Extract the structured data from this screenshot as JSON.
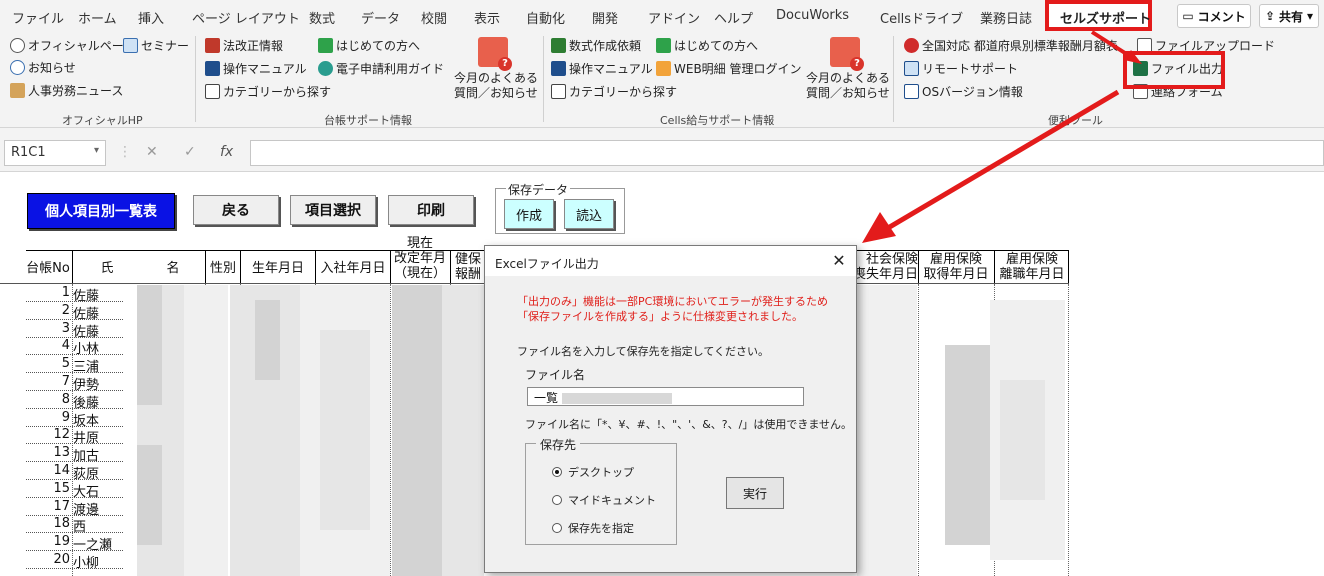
{
  "tabs": [
    "ファイル",
    "ホーム",
    "挿入",
    "ページ レイアウト",
    "数式",
    "データ",
    "校閲",
    "表示",
    "自動化",
    "開発",
    "アドイン",
    "ヘルプ",
    "DocuWorks",
    "Cellsドライブ",
    "業務日誌",
    "セルズサポート"
  ],
  "comment_label": "コメント",
  "share_label": "共有",
  "ribbon": {
    "official": {
      "items": [
        "オフィシャルページ",
        "セミナー",
        "お知らせ",
        "人事労務ニュース"
      ],
      "label": "オフィシャルHP"
    },
    "ledger": {
      "items": [
        "法改正情報",
        "はじめての方へ",
        "操作マニュアル",
        "電子申請利用ガイド",
        "カテゴリーから探す"
      ],
      "faq": "今月のよくある\n質問／お知らせ",
      "label": "台帳サポート情報"
    },
    "payroll": {
      "items": [
        "数式作成依頼",
        "はじめての方へ",
        "操作マニュアル",
        "WEB明細 管理ログイン",
        "カテゴリーから探す"
      ],
      "faq": "今月のよくある\n質問／お知らせ",
      "label": "Cells給与サポート情報"
    },
    "tools": {
      "items": [
        "全国対応 都道府県別標準報酬月額表",
        "ファイルアップロード",
        "リモートサポート",
        "ファイル出力",
        "OSバージョン情報",
        "連絡フォーム"
      ],
      "label": "便利ツール"
    }
  },
  "formula_bar": {
    "name_box": "R1C1",
    "fx": "fx"
  },
  "sheet": {
    "title_button": "個人項目別一覧表",
    "back_button": "戻る",
    "select_button": "項目選択",
    "print_button": "印刷",
    "save_group_label": "保存データ",
    "create_button": "作成",
    "load_button": "読込",
    "headers": [
      "台帳No",
      "氏",
      "名",
      "性別",
      "生年月日",
      "入社年月日",
      "現在\n改定年月\n（現在）",
      "健保\n報酬",
      "社会保険\n喪失年月日",
      "雇用保険\n取得年月日",
      "雇用保険\n離職年月日"
    ],
    "rows": [
      {
        "no": "1",
        "name": "佐藤"
      },
      {
        "no": "2",
        "name": "佐藤"
      },
      {
        "no": "3",
        "name": "佐藤"
      },
      {
        "no": "4",
        "name": "小林"
      },
      {
        "no": "5",
        "name": "三浦"
      },
      {
        "no": "7",
        "name": "伊勢"
      },
      {
        "no": "8",
        "name": "後藤"
      },
      {
        "no": "9",
        "name": "坂本"
      },
      {
        "no": "12",
        "name": "井原"
      },
      {
        "no": "13",
        "name": "加古"
      },
      {
        "no": "14",
        "name": "荻原"
      },
      {
        "no": "15",
        "name": "大石"
      },
      {
        "no": "17",
        "name": "渡邊"
      },
      {
        "no": "18",
        "name": "西"
      },
      {
        "no": "19",
        "name": "一之瀬"
      },
      {
        "no": "20",
        "name": "小柳"
      }
    ]
  },
  "dialog": {
    "title": "Excelファイル出力",
    "close": "✕",
    "warning_line1": "「出力のみ」機能は一部PC環境においてエラーが発生するため",
    "warning_line2": "「保存ファイルを作成する」ように仕様変更されました。",
    "instruction": "ファイル名を入力して保存先を指定してください。",
    "filename_label": "ファイル名",
    "filename_value": "一覧",
    "invalid_chars_note": "ファイル名に「*、¥、#、!、\"、'、&、?、/」は使用できません。",
    "destination_label": "保存先",
    "destinations": [
      "デスクトップ",
      "マイドキュメント",
      "保存先を指定"
    ],
    "selected_destination": 0,
    "exec_button": "実行"
  },
  "colors": {
    "highlight": "#e31b1b",
    "primary_button": "#0a12e4",
    "warning_text": "#e0201b",
    "cyan_button": "#ccffff"
  }
}
